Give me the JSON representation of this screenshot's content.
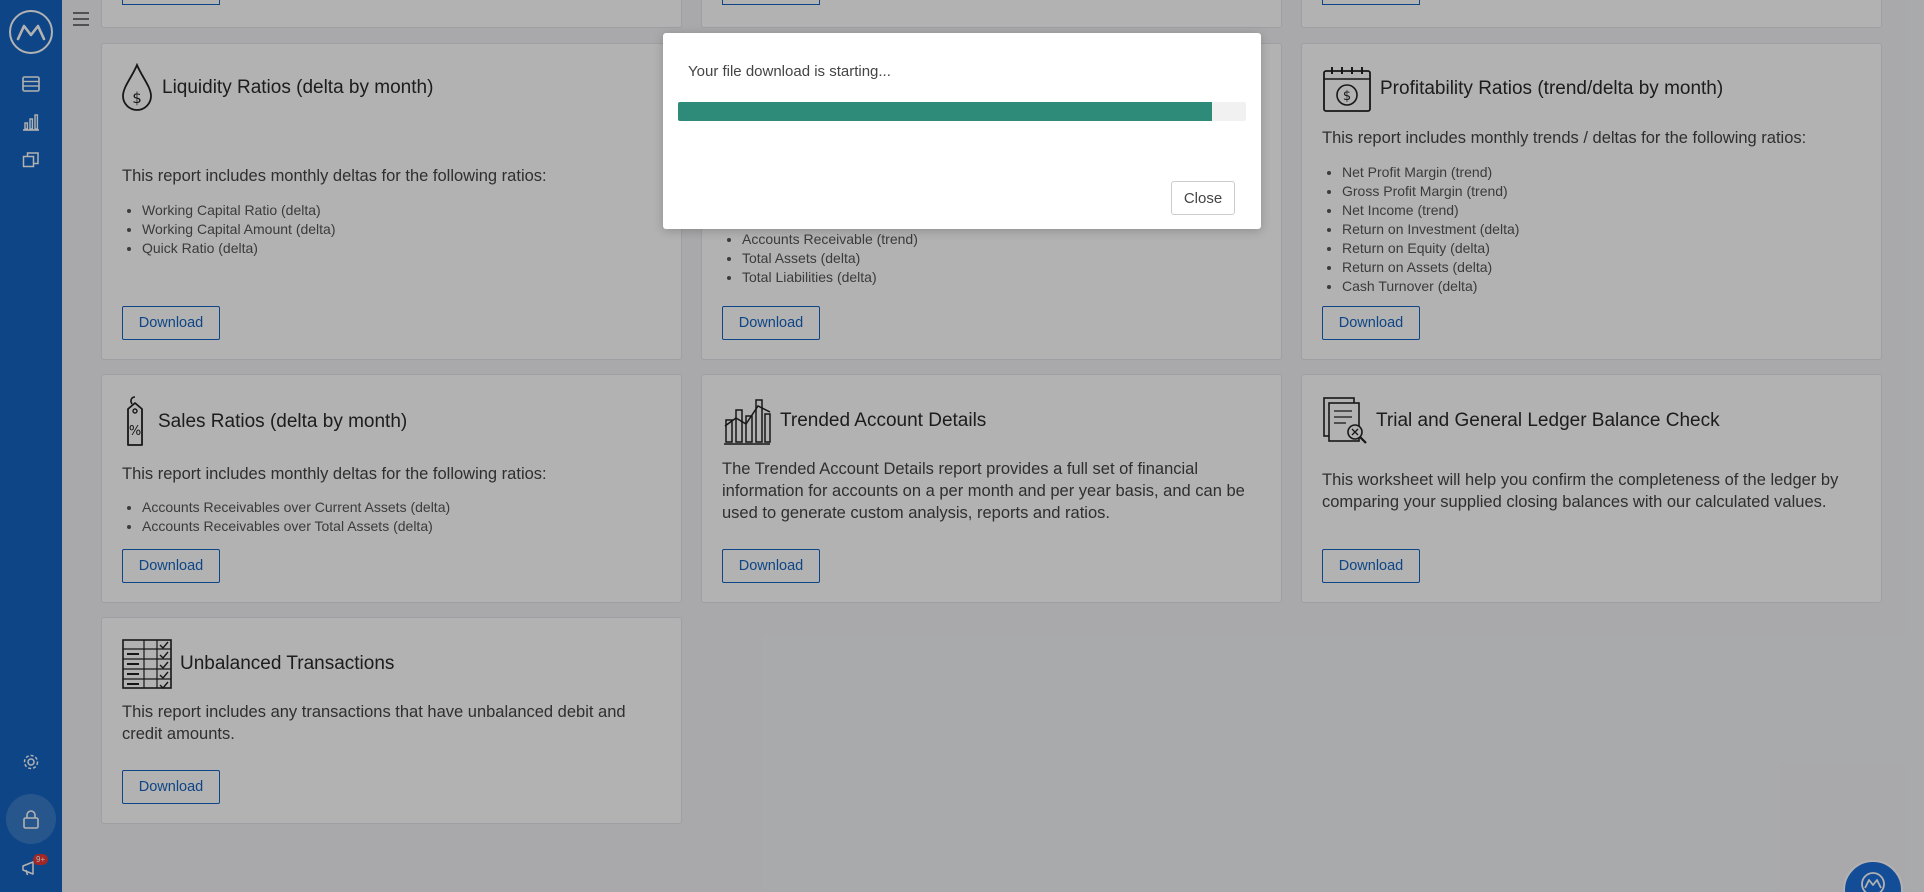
{
  "sidebar": {
    "logo": "app-logo",
    "items": [
      "list-icon",
      "bar-chart-icon",
      "copy-icon"
    ],
    "bottom": [
      "gear-icon",
      "lock-icon",
      "megaphone-icon"
    ],
    "notification_badge": "9+"
  },
  "cards": {
    "top_stub_buttons": 3,
    "liquidity": {
      "title": "Liquidity Ratios (delta by month)",
      "desc": "This report includes monthly deltas for the following ratios:",
      "items": [
        "Working Capital Ratio (delta)",
        "Working Capital Amount (delta)",
        "Quick Ratio (delta)"
      ],
      "button": "Download"
    },
    "balance": {
      "items": [
        "Accounts Receivable (trend)",
        "Total Assets (delta)",
        "Total Liabilities (delta)"
      ],
      "button": "Download"
    },
    "profitability": {
      "title": "Profitability Ratios (trend/delta by month)",
      "desc": "This report includes monthly trends / deltas for the following ratios:",
      "items": [
        "Net Profit Margin (trend)",
        "Gross Profit Margin (trend)",
        "Net Income (trend)",
        "Return on Investment (delta)",
        "Return on Equity (delta)",
        "Return on Assets (delta)",
        "Cash Turnover (delta)"
      ],
      "button": "Download"
    },
    "sales": {
      "title": "Sales Ratios (delta by month)",
      "desc": "This report includes monthly deltas for the following ratios:",
      "items": [
        "Accounts Receivables over Current Assets (delta)",
        "Accounts Receivables over Total Assets (delta)"
      ],
      "button": "Download"
    },
    "trended": {
      "title": "Trended Account Details",
      "desc": "The Trended Account Details report provides a full set of financial information for accounts on a per month and per year basis, and can be used to generate custom analysis, reports and ratios.",
      "button": "Download"
    },
    "trial": {
      "title": "Trial and General Ledger Balance Check",
      "desc": "This worksheet will help you confirm the completeness of the ledger by comparing your supplied closing balances with our calculated values.",
      "button": "Download"
    },
    "unbalanced": {
      "title": "Unbalanced Transactions",
      "desc": "This report includes any transactions that have unbalanced debit and credit amounts.",
      "button": "Download"
    }
  },
  "modal": {
    "message": "Your file download is starting...",
    "progress_percent": 94,
    "close_label": "Close",
    "progress_color": "#2e8b7a"
  },
  "colors": {
    "sidebar": "#1464c0",
    "accent": "#1464c0"
  }
}
